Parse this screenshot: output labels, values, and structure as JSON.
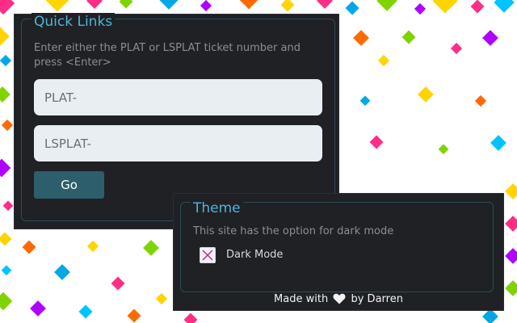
{
  "colors": {
    "panel_bg": "#1f2125",
    "accent": "#4fb6d6",
    "button_bg": "#2d5e6b",
    "input_bg": "#e9eef2",
    "muted_text": "#8a8e93"
  },
  "quick_links": {
    "title": "Quick Links",
    "description": "Enter either the PLAT or LSPLAT ticket number and press <Enter>",
    "plat_input": {
      "value": "",
      "placeholder": "PLAT-"
    },
    "lsplat_input": {
      "value": "",
      "placeholder": "LSPLAT-"
    },
    "go_label": "Go"
  },
  "theme": {
    "title": "Theme",
    "description": "This site has the option for dark mode",
    "dark_mode": {
      "label": "Dark Mode",
      "checked": true,
      "icon": "x-check-icon"
    }
  },
  "footer": {
    "prefix": "Made with",
    "icon": "heart-icon",
    "suffix": "by Darren"
  }
}
